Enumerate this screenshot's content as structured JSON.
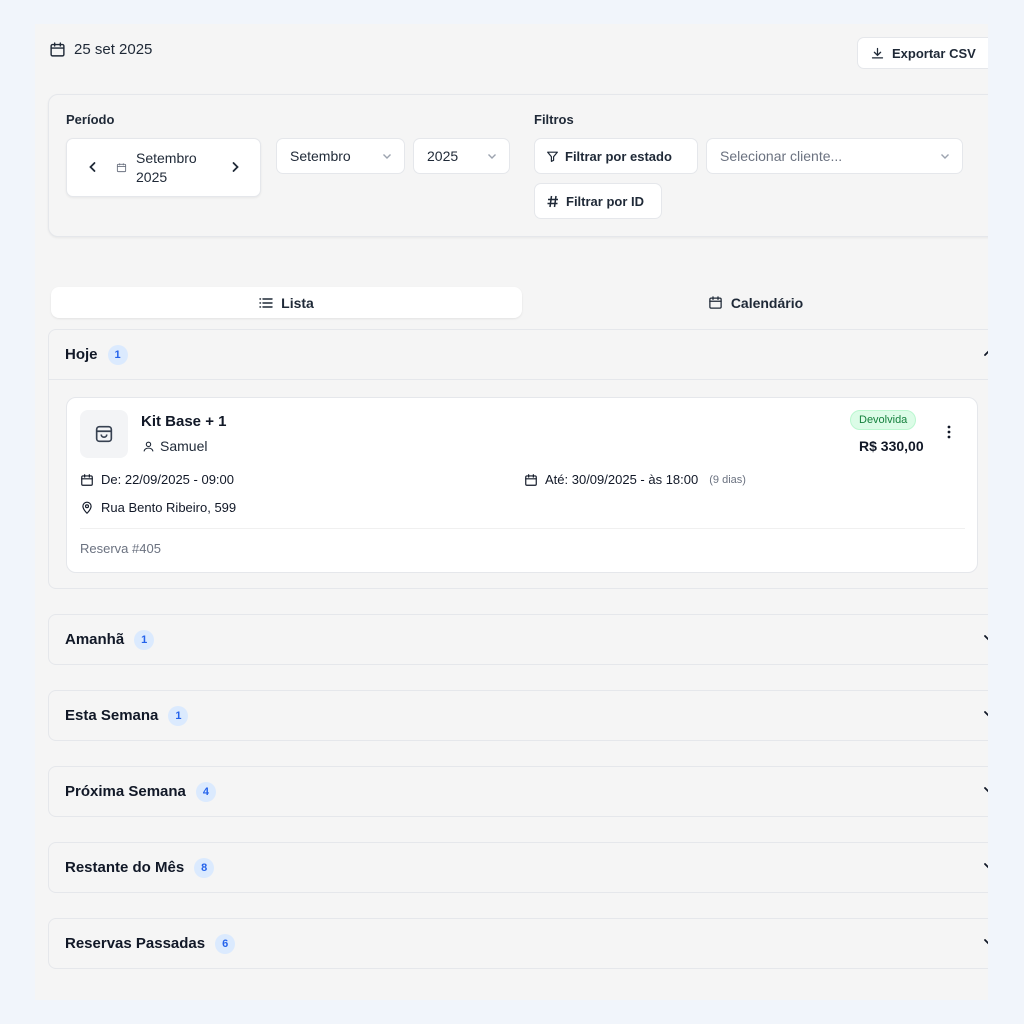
{
  "header": {
    "date": "25 set 2025",
    "export_label": "Exportar CSV"
  },
  "period": {
    "label": "Período",
    "nav_month": "Setembro",
    "nav_year": "2025",
    "month_select": "Setembro",
    "year_select": "2025"
  },
  "filters": {
    "label": "Filtros",
    "by_state": "Filtrar por estado",
    "client_placeholder": "Selecionar cliente...",
    "by_id": "Filtrar por ID"
  },
  "tabs": [
    {
      "label": "Lista",
      "icon": "list-icon",
      "active": true
    },
    {
      "label": "Calendário",
      "icon": "calendar-icon",
      "active": false
    }
  ],
  "sections": [
    {
      "title": "Hoje",
      "count": "1",
      "expanded": true
    },
    {
      "title": "Amanhã",
      "count": "1",
      "expanded": false
    },
    {
      "title": "Esta Semana",
      "count": "1",
      "expanded": false
    },
    {
      "title": "Próxima Semana",
      "count": "4",
      "expanded": false
    },
    {
      "title": "Restante do Mês",
      "count": "8",
      "expanded": false
    },
    {
      "title": "Reservas Passadas",
      "count": "6",
      "expanded": false
    }
  ],
  "booking": {
    "title": "Kit Base + 1",
    "client": "Samuel",
    "status": "Devolvida",
    "price": "R$ 330,00",
    "from": "De: 22/09/2025 - 09:00",
    "to": "Até: 30/09/2025 - às 18:00",
    "duration": "(9 dias)",
    "address": "Rua Bento Ribeiro, 599",
    "reference": "Reserva #405"
  },
  "colors": {
    "page_background": "#f1f5fb",
    "badge_background": "#dbeafe",
    "badge_text": "#2563eb",
    "status_background": "#dcfce7",
    "status_text": "#15803d"
  }
}
